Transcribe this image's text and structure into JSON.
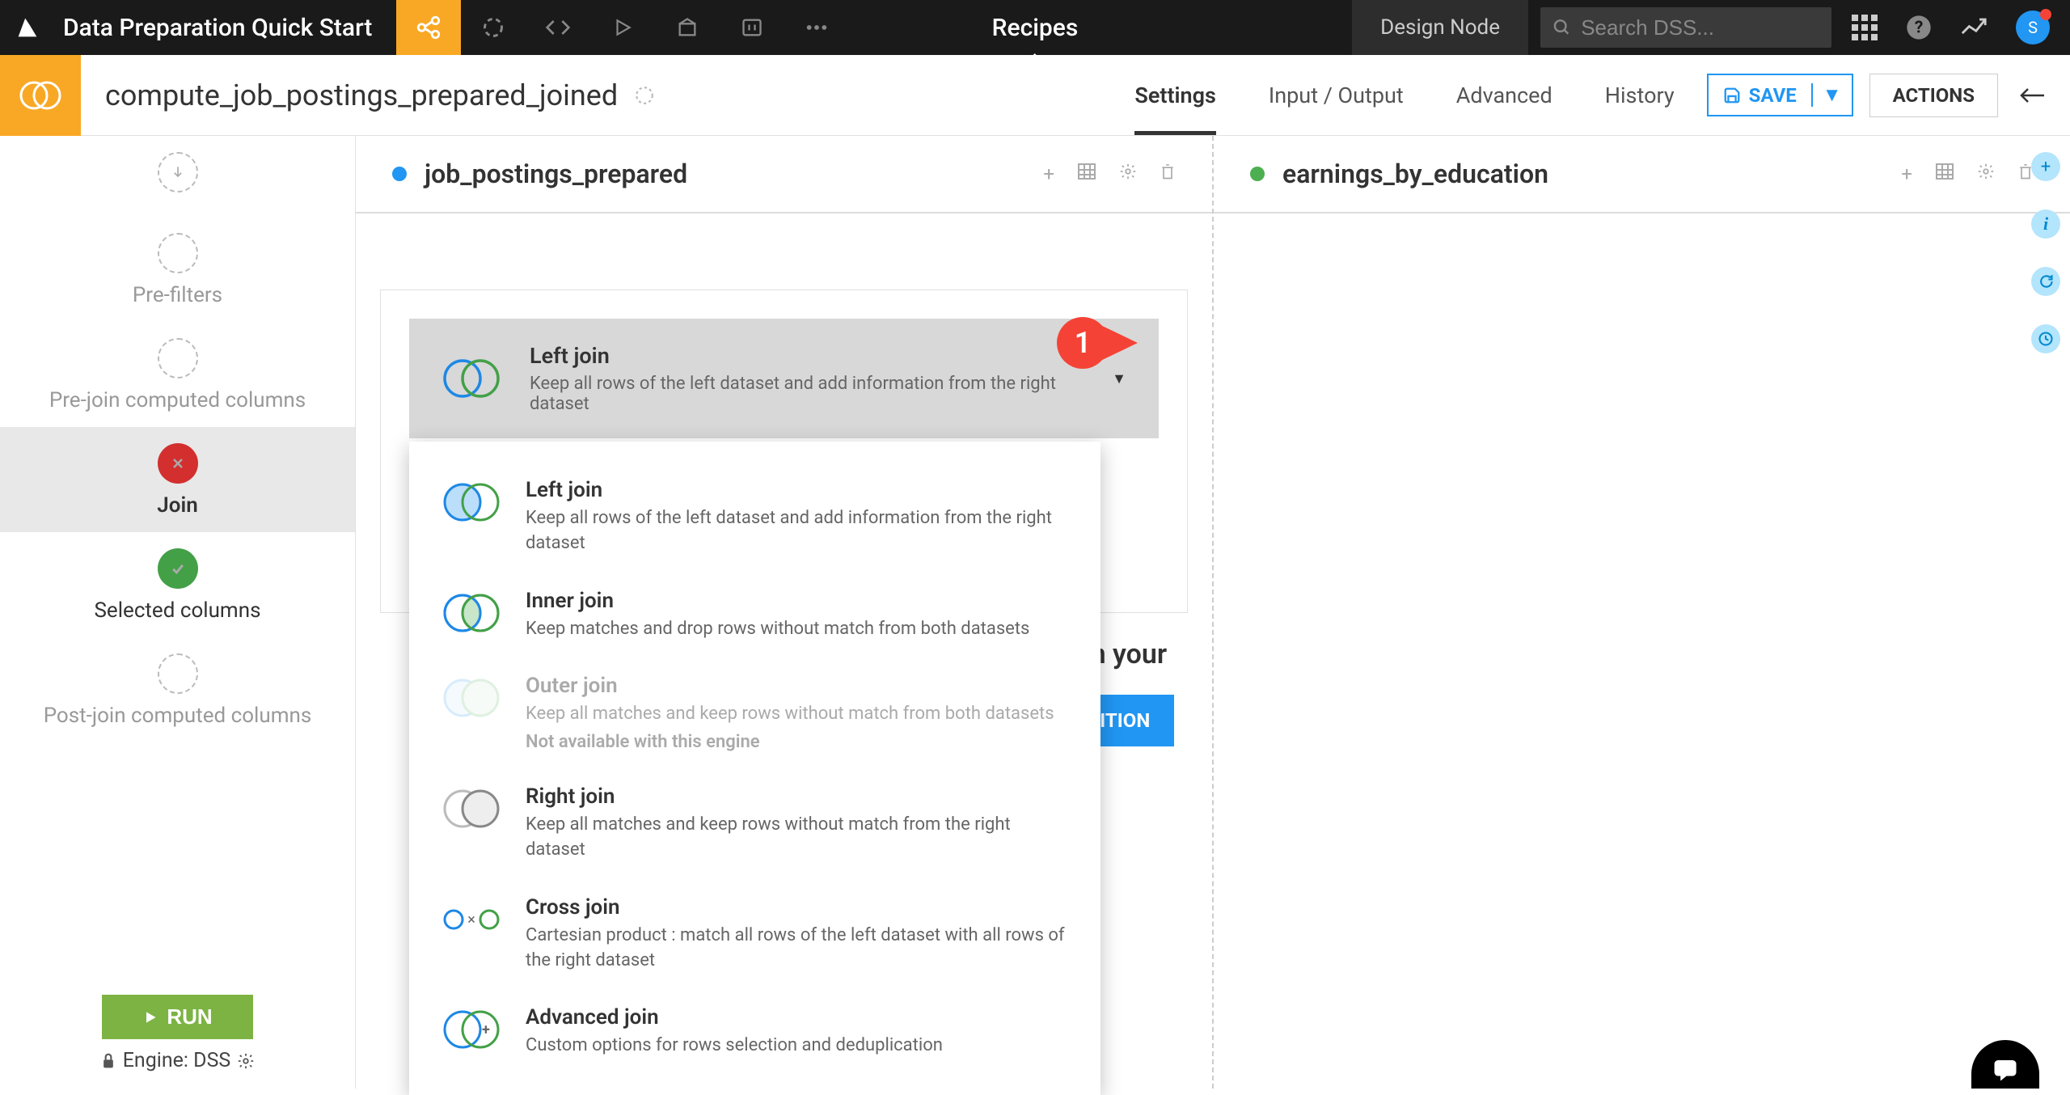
{
  "topbar": {
    "project_title": "Data Preparation Quick Start",
    "center_label": "Recipes",
    "design_node": "Design Node",
    "search_placeholder": "Search DSS...",
    "avatar_initial": "S"
  },
  "subheader": {
    "title": "compute_job_postings_prepared_joined",
    "tabs": [
      "Settings",
      "Input / Output",
      "Advanced",
      "History"
    ],
    "active_tab": 0,
    "save_label": "SAVE",
    "actions_label": "ACTIONS"
  },
  "sidebar": {
    "steps": [
      {
        "label": "",
        "state": "start"
      },
      {
        "label": "Pre-filters",
        "state": "default"
      },
      {
        "label": "Pre-join computed columns",
        "state": "default"
      },
      {
        "label": "Join",
        "state": "active"
      },
      {
        "label": "Selected columns",
        "state": "completed"
      },
      {
        "label": "Post-join computed columns",
        "state": "default"
      }
    ],
    "run_label": "RUN",
    "engine_label": "Engine: DSS"
  },
  "datasets": {
    "left_name": "job_postings_prepared",
    "right_name": "earnings_by_education"
  },
  "join": {
    "selected": {
      "title": "Left join",
      "desc": "Keep all rows of the left dataset and add information from the right dataset"
    },
    "options": [
      {
        "title": "Left join",
        "desc": "Keep all rows of the left dataset and add information from the right dataset",
        "type": "left",
        "disabled": false
      },
      {
        "title": "Inner join",
        "desc": "Keep matches and drop rows without match from both datasets",
        "type": "inner",
        "disabled": false
      },
      {
        "title": "Outer join",
        "desc": "Keep all matches and keep rows without match from both datasets",
        "type": "outer",
        "disabled": true,
        "na_text": "Not available with this engine"
      },
      {
        "title": "Right join",
        "desc": "Keep all matches and keep rows without match from the right dataset",
        "type": "right",
        "disabled": false
      },
      {
        "title": "Cross join",
        "desc": "Cartesian product : match all rows of the left dataset with all rows of the right dataset",
        "type": "cross",
        "disabled": false
      },
      {
        "title": "Advanced join",
        "desc": "Custom options for rows selection and deduplication",
        "type": "advanced",
        "disabled": false
      }
    ],
    "marker_number": "1",
    "select_text": "Select conditions to join your datasets",
    "add_condition_label": "+ ADD A CONDITION"
  }
}
